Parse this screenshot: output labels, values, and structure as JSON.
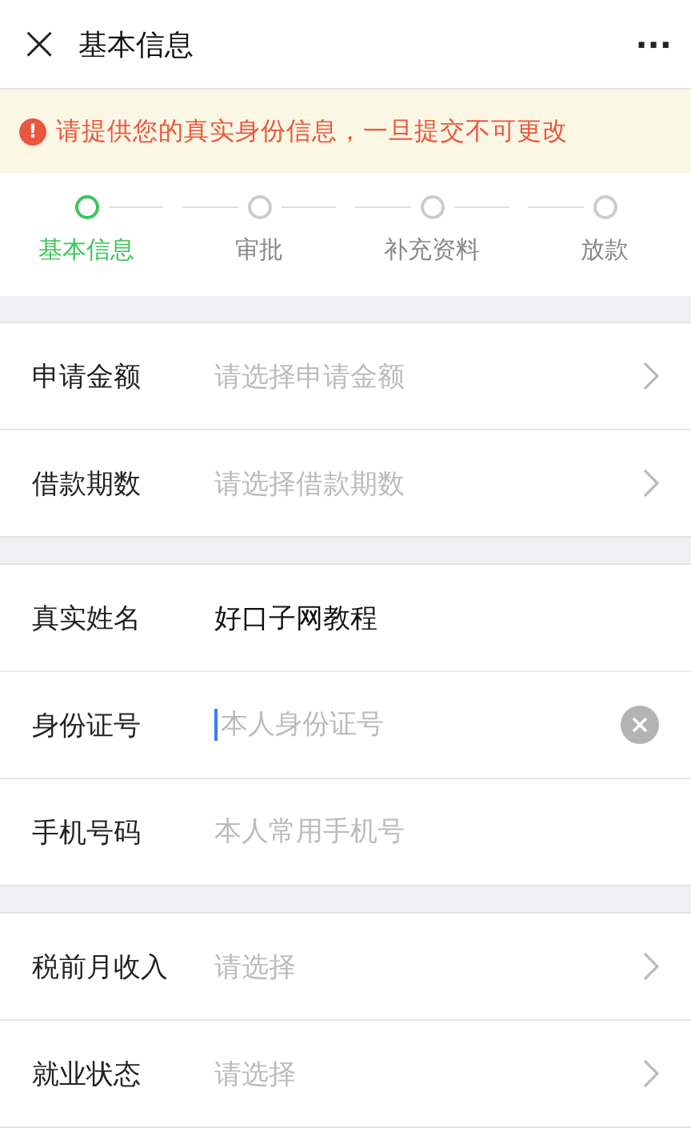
{
  "header": {
    "close": "×",
    "title": "基本信息",
    "more": "···"
  },
  "notice": {
    "icon": "!",
    "text": "请提供您的真实身份信息，一旦提交不可更改"
  },
  "steps": [
    {
      "label": "基本信息",
      "selected": true
    },
    {
      "label": "审批",
      "selected": false
    },
    {
      "label": "补充资料",
      "selected": false
    },
    {
      "label": "放款",
      "selected": false
    }
  ],
  "sections": [
    [
      {
        "kind": "select",
        "label": "申请金额",
        "placeholder": "请选择申请金额"
      },
      {
        "kind": "select",
        "label": "借款期数",
        "placeholder": "请选择借款期数"
      }
    ],
    [
      {
        "kind": "input",
        "label": "真实姓名",
        "value": "好口子网教程",
        "focused": false
      },
      {
        "kind": "input",
        "label": "身份证号",
        "placeholder": "本人身份证号",
        "focused": true
      },
      {
        "kind": "input",
        "label": "手机号码",
        "placeholder": "本人常用手机号",
        "focused": false
      }
    ],
    [
      {
        "kind": "select",
        "label": "税前月收入",
        "placeholder": "请选择"
      },
      {
        "kind": "select",
        "label": "就业状态",
        "placeholder": "请选择"
      }
    ]
  ]
}
